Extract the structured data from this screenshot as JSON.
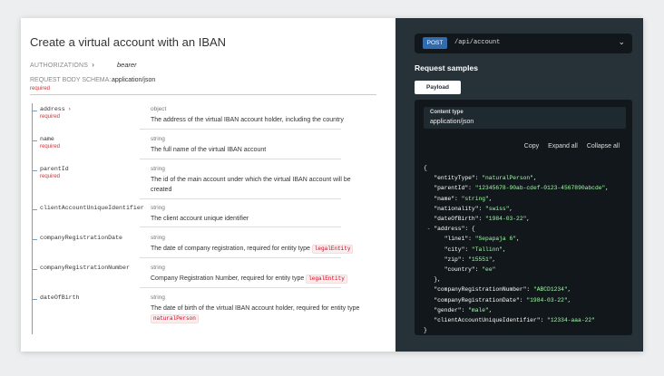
{
  "doc": {
    "title": "Create a virtual account with an IBAN",
    "authorizations_label": "AUTHORIZATIONS",
    "authorizations_value": "bearer",
    "request_body_label": "REQUEST BODY SCHEMA:",
    "request_body_value": "application/json",
    "required_label": "required",
    "properties": [
      {
        "name": "address",
        "expandable": true,
        "required": "required",
        "type": "object",
        "desc": "The address of the virtual IBAN account holder, including the country"
      },
      {
        "name": "name",
        "required": "required",
        "type": "string",
        "desc": "The full name of the virtual IBAN account"
      },
      {
        "name": "parentId",
        "required": "required",
        "type": "string",
        "desc": "The id of the main account under which the virtual IBAN account will be created"
      },
      {
        "name": "clientAccountUniqueIdentifier",
        "type": "string",
        "desc": "The client account unique identifier"
      },
      {
        "name": "companyRegistrationDate",
        "type": "string",
        "desc": "The date of company registration, required for entity type",
        "badge": "legalEntity"
      },
      {
        "name": "companyRegistrationNumber",
        "type": "string",
        "desc": "Company Registration Number, required for entity type",
        "badge": "legalEntity"
      },
      {
        "name": "dateOfBirth",
        "type": "string",
        "desc": "The date of birth of the virtual IBAN account holder, required for entity type",
        "badge": "naturalPerson"
      }
    ]
  },
  "samples": {
    "method": "POST",
    "path": "/api/account",
    "section_title": "Request samples",
    "tab_label": "Payload",
    "content_type_label": "Content type",
    "content_type_value": "application/json",
    "copy_label": "Copy",
    "expand_all_label": "Expand all",
    "collapse_all_label": "Collapse all",
    "code_lines": [
      "{",
      "\"entityType\": \"naturalPerson\",",
      "\"parentId\": \"12345678-90ab-cdef-0123-4567890abcde\",",
      "\"name\": \"string\",",
      "\"nationality\": \"swiss\",",
      "\"dateOfBirth\": \"1984-03-22\",",
      "\"address\": {",
      "\"line1\": \"Sepapaja 6\",",
      "\"city\": \"Tallinn\",",
      "\"zip\": \"15551\",",
      "\"country\": \"ee\"",
      "},",
      "\"companyRegistrationNumber\": \"ABCD1234\",",
      "\"companyRegistrationDate\": \"1984-03-22\",",
      "\"gender\": \"male\",",
      "\"clientAccountUniqueIdentifier\": \"12334-aaa-22\"",
      "}"
    ]
  },
  "colors": {
    "dark_panel": "#263238",
    "code_bg": "#11171a",
    "post_badge": "#326cb0",
    "string_value": "#a0fbaa",
    "required_text": "#cc3333",
    "badge_text": "#d0021b"
  }
}
